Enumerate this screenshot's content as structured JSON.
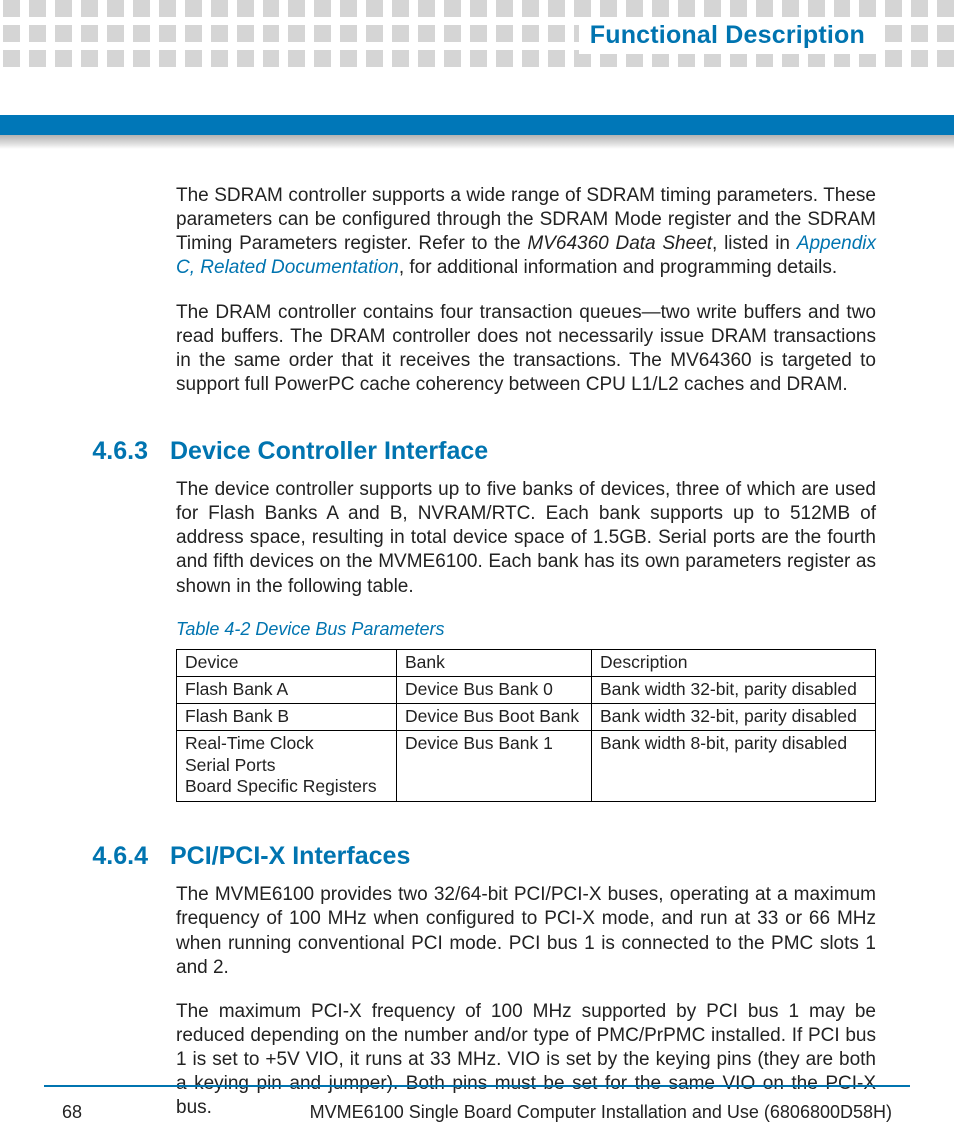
{
  "header": {
    "title": "Functional Description"
  },
  "body": {
    "para1_a": "The SDRAM controller supports a wide range of SDRAM timing parameters. These parameters can be configured through the SDRAM Mode register and the SDRAM Timing Parameters register. Refer to the ",
    "para1_emph": "MV64360 Data Sheet",
    "para1_b": ", listed in ",
    "para1_link": "Appendix C, Related Documentation",
    "para1_c": ", for additional information and programming details.",
    "para2": "The DRAM controller contains four transaction queues—two write buffers and two read buffers. The DRAM controller does not necessarily issue DRAM transactions in the same order that it receives the transactions. The MV64360 is targeted to support full PowerPC cache coherency between CPU L1/L2 caches and DRAM."
  },
  "sections": {
    "device_ctrl": {
      "num": "4.6.3",
      "title": "Device Controller Interface",
      "para": "The device controller supports up to five banks of devices, three of which are used for Flash Banks A and B, NVRAM/RTC. Each bank supports up to 512MB of address space, resulting in total device space of 1.5GB. Serial ports are the fourth and fifth devices on the MVME6100. Each bank has its own parameters register as shown in the following table."
    },
    "pci": {
      "num": "4.6.4",
      "title": "PCI/PCI-X Interfaces",
      "para1": "The MVME6100 provides two 32/64-bit PCI/PCI-X buses, operating at a maximum frequency of 100 MHz when configured to PCI-X mode, and run at 33 or 66 MHz when running conventional PCI mode. PCI bus 1 is connected to the PMC slots 1 and 2.",
      "para2": "The maximum PCI-X frequency of 100 MHz supported by PCI bus 1 may be reduced depending on the number and/or type of PMC/PrPMC installed. If PCI bus 1 is set to +5V VIO, it runs at 33 MHz. VIO is set by the keying pins (they are both a keying pin and jumper). Both pins must be set for the same VIO on the PCI-X bus."
    }
  },
  "table": {
    "caption": "Table 4-2 Device Bus Parameters",
    "headers": [
      "Device",
      "Bank",
      "Description"
    ],
    "rows": [
      {
        "device": "Flash Bank A",
        "bank": "Device Bus Bank 0",
        "desc": "Bank width 32-bit, parity disabled"
      },
      {
        "device": "Flash Bank B",
        "bank": "Device Bus Boot Bank",
        "desc": "Bank width 32-bit, parity disabled"
      },
      {
        "device": "Real-Time Clock\nSerial Ports\nBoard Specific Registers",
        "bank": "Device Bus Bank 1",
        "desc": "Bank width 8-bit, parity disabled"
      }
    ]
  },
  "footer": {
    "page": "68",
    "doc": "MVME6100 Single Board Computer Installation and Use (6806800D58H)"
  }
}
